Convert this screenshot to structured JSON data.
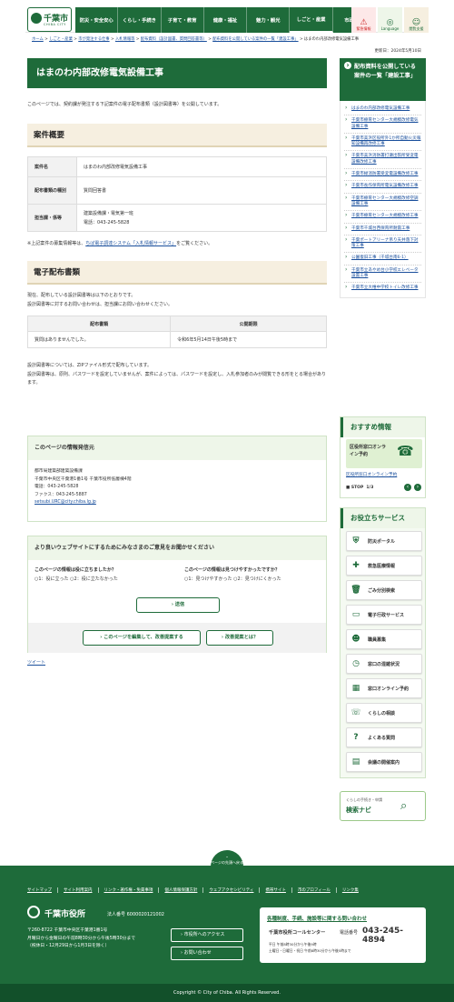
{
  "header": {
    "logo_name": "千葉市",
    "logo_sub": "CHIBA CITY",
    "nav": [
      "防災・安全安心",
      "くらし・手続き",
      "子育て・教育",
      "健康・福祉",
      "魅力・観光",
      "しごと・産業",
      "市政全般"
    ],
    "emergency": "緊急情報",
    "language": "Language",
    "reading": "閲覧支援"
  },
  "breadcrumb": [
    "ホーム",
    "しごと・産業",
    "市が発注する仕事",
    "入札情報等",
    "配布資料（設計図書、質問回答書等）",
    "配布資料を公開している案件の一覧「建設工事」",
    "はまのわ内部改修電気設備工事"
  ],
  "updated": "更新日：2024年5月10日",
  "main": {
    "title": "はまのわ内部改修電気設備工事",
    "intro": "このページでは、契約課が発注する下記案件の電子配布書類（設計図書等）を公開しています。",
    "overview_heading": "案件概要",
    "overview": [
      {
        "k": "案件名",
        "v": "はまのわ内部改修電気設備工事"
      },
      {
        "k": "配布書類の種別",
        "v": "質問回答書"
      },
      {
        "k": "担当課・係等",
        "v": "建築設備課・電気第一班",
        "v2": "電話：043-245-5828"
      }
    ],
    "note_prefix": "※上記案件の募集情報等は、",
    "note_link": "ちば電子調達システム「入札情報サービス」",
    "note_suffix": "をご覧ください。",
    "docs_heading": "電子配布書類",
    "docs_para1": "現在、配布している設計図書等は以下のとおりです。",
    "docs_para2": "設計図書等に対するお問い合わせは、担当課にお問い合わせください。",
    "docs_table_header": [
      "配布書類",
      "公開期限"
    ],
    "docs_table_row": [
      "質問はありませんでした。",
      "令和6年5月14日午後5時まで"
    ],
    "zip_para1": "設計図書等については、ZIPファイル形式で配布しています。",
    "zip_para2": "設計図書等は、原則、パスワードを設定していませんが、案件によっては、パスワードを設定し、入札参加者のみが閲覧できる形をとる場合があります。"
  },
  "contact": {
    "heading": "このページの情報発信元",
    "dept": "都市局建築部建築設備課",
    "address": "千葉市中央区千葉港1番1号 千葉市役所低層棟4階",
    "tel": "電話：043-245-5828",
    "fax": "ファクス：043-245-5887",
    "email": "setsubi.URC@city.chiba.lg.jp"
  },
  "survey": {
    "heading": "より良いウェブサイトにするためにみなさまのご意見をお聞かせください",
    "q1": "このページの情報は役に立ちましたか？",
    "q1_opt1": "1：役に立った",
    "q1_opt2": "2：役に立たなかった",
    "q2": "このページの情報は見つけやすかったですか？",
    "q2_opt1": "1：見つけやすかった",
    "q2_opt2": "2：見つけにくかった",
    "submit": "送信",
    "edit_button": "このページを編集して、改善提案する",
    "about_button": "改善提案とは？"
  },
  "tweet": "ツイート",
  "sidebar": {
    "heading": "配布資料を公開している案件の一覧「建設工事」",
    "items": [
      "はまのわ内部改修電気設備工事",
      "千葉市療育センター大規模改修電気設備工事",
      "千葉市美浜区役所外1か所自動火災報知設備再改修工事",
      "千葉市美浜消防署打瀬出張所受変電設備改修工事",
      "千葉市緑消防署受変電設備改修工事",
      "千葉市長作保育所電気設備改修工事",
      "千葉市療育センター大規模改修空調設備工事",
      "千葉市療育センター大規模改修工事",
      "千葉市千城台西保育所耐震工事",
      "千葉ポートアリーナ吊り天井落下対策工事",
      "公園復旧工事（千城台南6-1）",
      "千葉市立あやめ台小学校エレベータ設置工事",
      "千葉市立大椎中学校トイレ改修工事"
    ],
    "recommend_heading": "おすすめ情報",
    "recommend_banner": "区役所窓口オンライン予約",
    "recommend_link": "区役所窓口オンライン予約",
    "stop": "STOP",
    "counter": "1/3",
    "services_heading": "お役立ちサービス",
    "services": [
      {
        "label": "防災ポータル",
        "icon": "shield-icon"
      },
      {
        "label": "救急医療情報",
        "icon": "ambulance-icon"
      },
      {
        "label": "ごみ分別検索",
        "icon": "trash-icon"
      },
      {
        "label": "電子行政サービス",
        "icon": "laptop-icon"
      },
      {
        "label": "職員募集",
        "icon": "people-icon"
      },
      {
        "label": "窓口の混雑状況",
        "icon": "clock-icon"
      },
      {
        "label": "窓口オンライン予約",
        "icon": "calendar-icon"
      },
      {
        "label": "くらしの相談",
        "icon": "chat-icon"
      },
      {
        "label": "よくある質問",
        "icon": "question-icon"
      },
      {
        "label": "会議の開催案内",
        "icon": "grid-icon"
      }
    ],
    "navi_small": "くらしの手続き・申請",
    "navi_label": "検索ナビ"
  },
  "footer": {
    "to_top": "ページの先頭へ戻る",
    "links": [
      "サイトマップ",
      "サイト利用案内",
      "リンク・著作権・免責事項",
      "個人情報保護方針",
      "ウェブアクセシビリティ",
      "携帯サイト",
      "市のプロフィール",
      "リンク集"
    ],
    "office": "千葉市役所",
    "corp_no": "法人番号 6000020121002",
    "address1": "〒260-8722 千葉市中央区千葉港1番1号",
    "address2": "月曜日から金曜日の午前8時30分から午後5時30分まで",
    "address3": "（祝休日・12月29日から1月3日を除く）",
    "access_button": "市役所へのアクセス",
    "contact_button": "お問い合わせ",
    "call_title": "各種制度、手続、施設等に関する問い合わせ",
    "call_center": "千葉市役所コールセンター",
    "call_tel_label": "電話番号",
    "call_tel": "043-245-4894",
    "call_hours1": "平日 午前8時30分から午後9時",
    "call_hours2": "土曜日・日曜日・祝日 午前8時30分から午後5時まで",
    "copyright": "Copyright © City of Chiba. All Rights Reserved."
  },
  "colors": {
    "brand": "#1e6b3a",
    "heading_bg": "#f6efe0",
    "link": "#1a4f9c"
  }
}
